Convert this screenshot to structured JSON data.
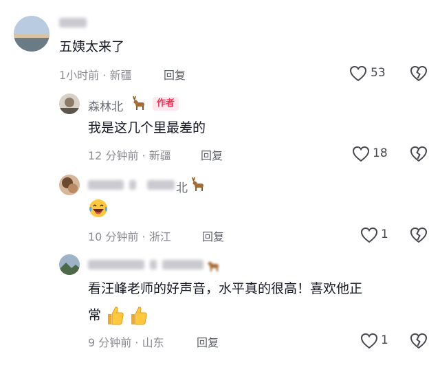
{
  "comments": [
    {
      "text": "五姨太来了",
      "time": "1小时前",
      "location": "新疆",
      "reply": "回复",
      "likes": "53"
    },
    {
      "author": "森林北",
      "badge": "作者",
      "text": "我是这几个里最差的",
      "time": "12 分钟前",
      "location": "新疆",
      "reply": "回复",
      "likes": "18"
    },
    {
      "author_visible": "北",
      "time": "10 分钟前",
      "location": "浙江",
      "reply": "回复",
      "likes": "1"
    },
    {
      "text_line1": "看汪峰老师的好声音，水平真的很高！喜欢他正",
      "text_line2": "常",
      "time": "9 分钟前",
      "location": "山东",
      "reply": "回复",
      "likes": "1"
    }
  ],
  "separator": "·",
  "icons": [
    "heart-icon",
    "broken-heart-icon",
    "deer-emoji-icon",
    "laughing-cry-emoji-icon",
    "thumbs-up-emoji-icon"
  ],
  "colors": {
    "author_badge": "#fe2c55",
    "meta": "#8a8b91",
    "text": "#161823"
  }
}
